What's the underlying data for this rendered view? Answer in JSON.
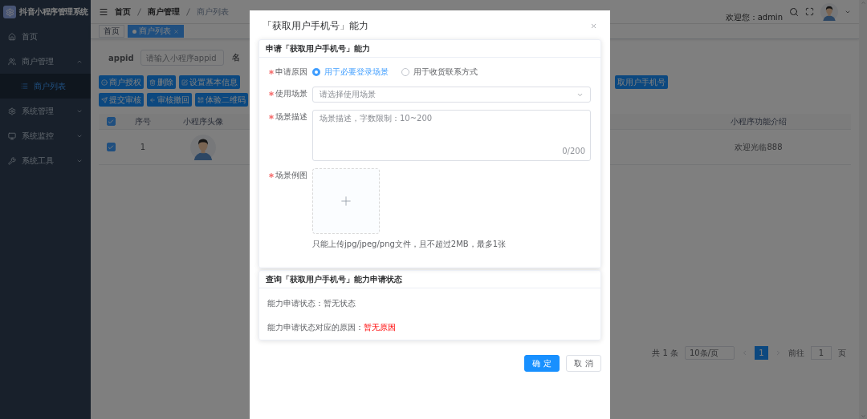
{
  "sidebar": {
    "title": "抖音小程序管理系统",
    "items": [
      {
        "label": "首页",
        "kind": "link"
      },
      {
        "label": "商户管理",
        "kind": "group",
        "expanded": true,
        "children": [
          {
            "label": "商户列表",
            "selected": true
          }
        ]
      },
      {
        "label": "系统管理",
        "kind": "group",
        "expanded": false
      },
      {
        "label": "系统监控",
        "kind": "group",
        "expanded": false
      },
      {
        "label": "系统工具",
        "kind": "group",
        "expanded": false
      }
    ]
  },
  "header": {
    "breadcrumb": [
      "首页",
      "商户管理",
      "商户列表"
    ],
    "welcome": "欢迎您：admin"
  },
  "tags": [
    {
      "label": "首页",
      "selected": false
    },
    {
      "label": "商户列表",
      "selected": true
    }
  ],
  "search": {
    "label": "appid",
    "placeholder": "请输入小程序appid",
    "next_label": "名"
  },
  "toolbar": {
    "rows": [
      [
        "商户授权",
        "删除",
        "设置基本信息"
      ],
      [
        "提交审核",
        "审核撤回",
        "体验二维码"
      ]
    ],
    "right_button": "取用户手机号"
  },
  "table": {
    "header_checked": true,
    "columns": [
      "序号",
      "小程序头像",
      "小程序功能介绍"
    ],
    "rows": [
      {
        "checked": true,
        "index": "1",
        "intro": "欢迎光临888"
      }
    ]
  },
  "pagination": {
    "total": "共 1 条",
    "page_size": "10条/页",
    "pages": [
      {
        "label": "1",
        "selected": true
      }
    ],
    "goto_label": "前往",
    "goto_value": "1",
    "goto_suffix": "页"
  },
  "dialog": {
    "title": "「获取用户手机号」能力",
    "apply": {
      "title": "申请「获取用户手机号」能力",
      "reason": {
        "label": "申请原因",
        "required": true,
        "options": [
          {
            "label": "用于必要登录场景",
            "selected": true
          },
          {
            "label": "用于收货联系方式",
            "selected": false
          }
        ]
      },
      "scene": {
        "label": "使用场景",
        "required": true,
        "placeholder": "请选择使用场景"
      },
      "description": {
        "label": "场景描述",
        "required": true,
        "placeholder": "场景描述，字数限制：10~200",
        "counter": "0/200"
      },
      "example": {
        "label": "场景例图",
        "required": true,
        "hint": "只能上传jpg/jpeg/png文件，且不超过2MB，最多1张"
      }
    },
    "status": {
      "title": "查询「获取用户手机号」能力申请状态",
      "lines": [
        {
          "label": "能力申请状态：",
          "value": "暂无状态",
          "kind": "normal"
        },
        {
          "label": "能力申请状态对应的原因：",
          "value": "暂无原因",
          "kind": "error"
        }
      ]
    },
    "buttons": [
      {
        "label": "确 定",
        "kind": "primary"
      },
      {
        "label": "取 消",
        "kind": "default"
      }
    ]
  }
}
